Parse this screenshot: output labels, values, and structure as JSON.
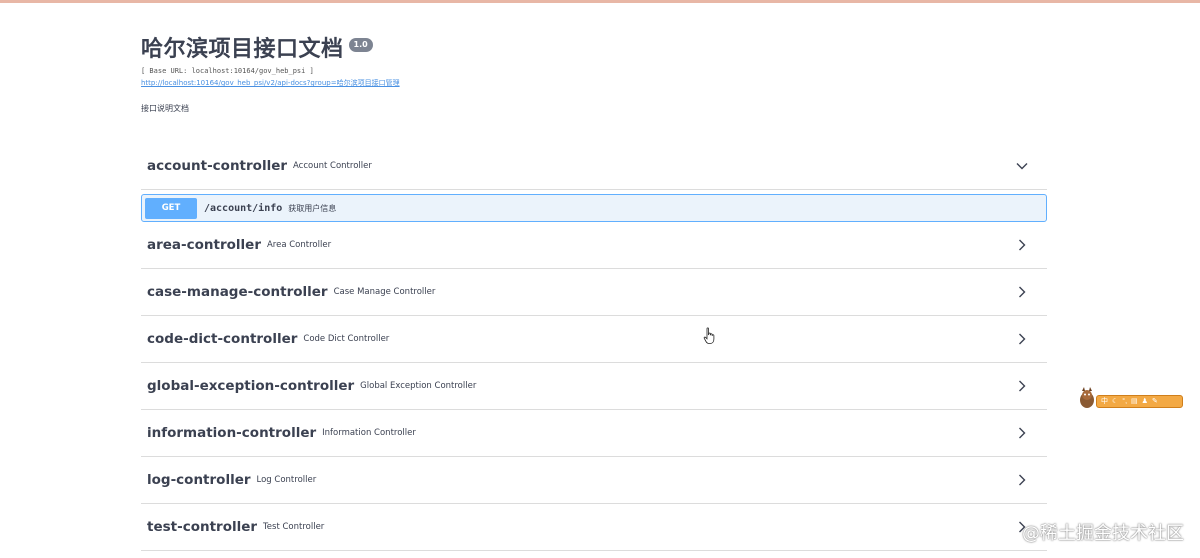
{
  "info": {
    "title": "哈尔滨项目接口文档",
    "version": "1.0",
    "base_url": "[ Base URL: localhost:10164/gov_heb_psi ]",
    "api_docs_link": "http://localhost:10164/gov_heb_psi/v2/api-docs?group=哈尔滨项目接口管理",
    "description": "接口说明文档"
  },
  "sections": [
    {
      "name": "account-controller",
      "description": "Account Controller",
      "expanded": true,
      "operations": [
        {
          "method": "GET",
          "path": "/account/info",
          "summary": "获取用户信息"
        }
      ]
    },
    {
      "name": "area-controller",
      "description": "Area Controller",
      "expanded": false
    },
    {
      "name": "case-manage-controller",
      "description": "Case Manage Controller",
      "expanded": false
    },
    {
      "name": "code-dict-controller",
      "description": "Code Dict Controller",
      "expanded": false
    },
    {
      "name": "global-exception-controller",
      "description": "Global Exception Controller",
      "expanded": false
    },
    {
      "name": "information-controller",
      "description": "Information Controller",
      "expanded": false
    },
    {
      "name": "log-controller",
      "description": "Log Controller",
      "expanded": false
    },
    {
      "name": "test-controller",
      "description": "Test Controller",
      "expanded": false
    }
  ],
  "icons": {
    "expanded": "chevron-down-icon",
    "collapsed": "chevron-right-icon",
    "cursor": "hand-pointer-icon"
  },
  "colors": {
    "get_method": "#61affe",
    "get_background": "#ebf3fb",
    "title_text": "#3b4151",
    "link": "#4990e2",
    "top_line": "#e8b7a6"
  },
  "extension_toolbar": {
    "label": "中",
    "color": "#f3a944"
  },
  "watermark": {
    "text": "@稀土掘金技术社区"
  }
}
